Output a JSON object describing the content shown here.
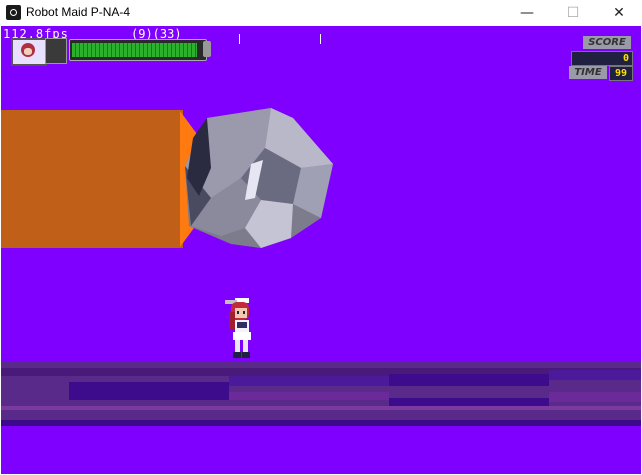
{
  "window": {
    "title": "Robot Maid P-NA-4",
    "minimize_glyph": "—",
    "maximize_glyph": "☐",
    "close_glyph": "✕"
  },
  "hud": {
    "fps": "112.8fps",
    "counters": "(9)(33)",
    "hp_fraction": 0.95,
    "score_label": "SCORE",
    "score_value": "0",
    "time_label": "TIME",
    "time_value": "99"
  },
  "scene": {
    "background_color": "#8000ff",
    "arm_color": "#c06018",
    "fist_color": "#8a8a98",
    "floor_color": "#5a2a8a"
  }
}
